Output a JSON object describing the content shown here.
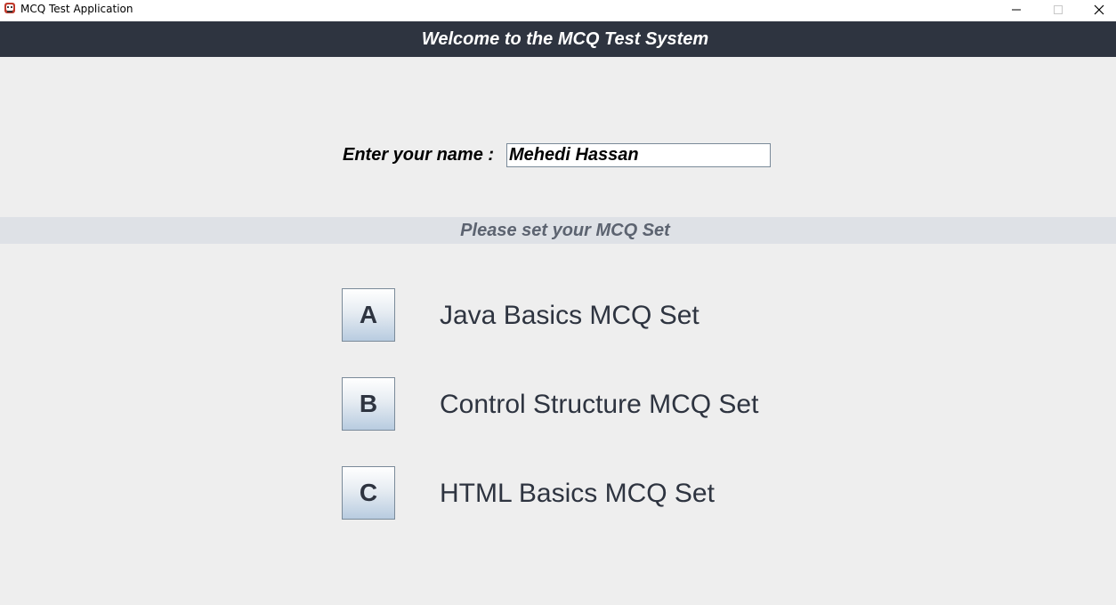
{
  "window": {
    "title": "MCQ Test Application",
    "icon": "app-cat-icon",
    "controls": [
      "minimize-icon",
      "maximize-icon",
      "close-icon"
    ]
  },
  "header": {
    "title": "Welcome to the MCQ Test System",
    "background": "#2e3440"
  },
  "name_form": {
    "label": "Enter your name :",
    "value": "Mehedi Hassan"
  },
  "subheader": {
    "text": "Please set your MCQ Set",
    "background": "#dee1e6"
  },
  "mcq_sets": [
    {
      "button": "A",
      "label": "Java Basics MCQ Set"
    },
    {
      "button": "B",
      "label": "Control Structure MCQ Set"
    },
    {
      "button": "C",
      "label": "HTML Basics MCQ Set"
    }
  ],
  "colors": {
    "window_background": "#eeeeee",
    "text_dark": "#2e3440",
    "subheader_text": "#5c6370"
  }
}
